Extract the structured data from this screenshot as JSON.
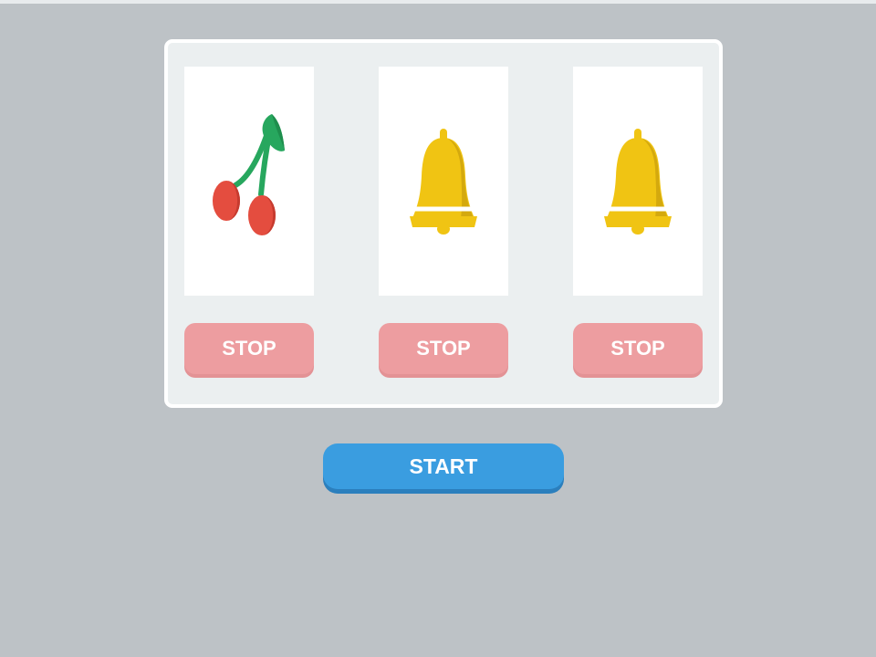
{
  "reels": [
    {
      "symbol": "cherry-icon",
      "stop_label": "STOP"
    },
    {
      "symbol": "bell-icon",
      "stop_label": "STOP"
    },
    {
      "symbol": "bell-icon",
      "stop_label": "STOP"
    }
  ],
  "controls": {
    "start_label": "START"
  },
  "colors": {
    "background": "#bdc2c6",
    "panel": "#ebeff0",
    "stop_button": "#ed9da0",
    "start_button": "#3a9de0",
    "cherry": "#e44d3f",
    "leaf": "#27a75e",
    "bell": "#f0c413"
  }
}
